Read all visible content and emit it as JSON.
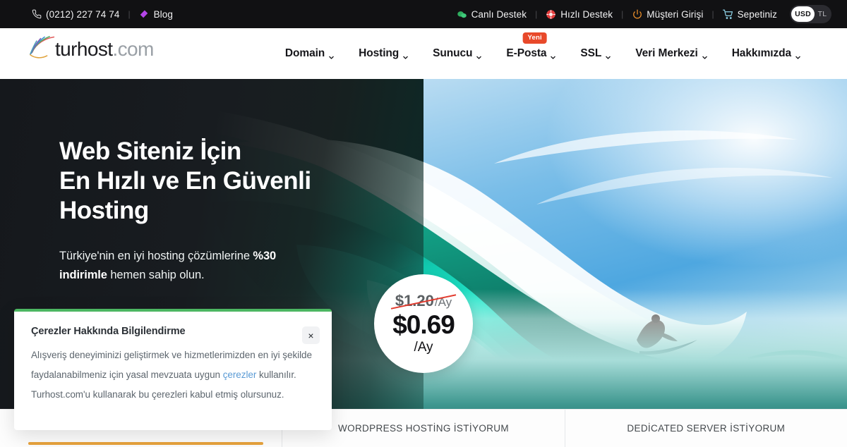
{
  "topbar": {
    "phone": "(0212) 227 74 74",
    "blog": "Blog",
    "live_support": "Canlı Destek",
    "fast_support": "Hızlı Destek",
    "client_login": "Müşteri Girişi",
    "cart": "Sepetiniz",
    "currency_active": "USD",
    "currency_inactive": "TL",
    "separator": "|",
    "colors": {
      "bg": "#111113",
      "live_support_icon": "#2fae5f",
      "fast_support_icon": "#e23b3b",
      "client_login_icon": "#f0922b",
      "cart_icon": "#8fd3e8"
    }
  },
  "header": {
    "logo_text_1": "turhost",
    "logo_text_2": ".com",
    "nav": [
      {
        "label": "Domain",
        "badge": null
      },
      {
        "label": "Hosting",
        "badge": null
      },
      {
        "label": "Sunucu",
        "badge": null
      },
      {
        "label": "E-Posta",
        "badge": "Yeni"
      },
      {
        "label": "SSL",
        "badge": null
      },
      {
        "label": "Veri Merkezi",
        "badge": null
      },
      {
        "label": "Hakkımızda",
        "badge": null
      }
    ]
  },
  "hero": {
    "title": "Web Siteniz İçin\nEn Hızlı ve En Güvenli\nHosting",
    "sub_before": "Türkiye'nin en iyi hosting çözümlerine ",
    "sub_strong": "%30 indirimle",
    "sub_after": " hemen sahip olun.",
    "price": {
      "old_amount": "$1.20",
      "old_period": "/Ay",
      "new_amount": "$0.69",
      "new_period": "/Ay",
      "strike_color": "#e23b2e"
    }
  },
  "tabs": [
    {
      "label": "",
      "active": true
    },
    {
      "label": "WORDPRESS HOSTİNG İSTİYORUM",
      "active": false
    },
    {
      "label": "DEDİCATED SERVER İSTİYORUM",
      "active": false
    }
  ],
  "tab_accent": "#e8a33d",
  "cookie": {
    "title": "Çerezler Hakkında Bilgilendirme",
    "line1": "Alışveriş deneyiminizi geliştirmek ve hizmetlerimizden en iyi",
    "line2_before": "şekilde faydalanabilmeniz için yasal mevzuata uygun ",
    "link": "çerezler",
    "line3": "kullanılır. Turhost.com'u kullanarak bu çerezleri kabul etmiş",
    "line4": "olursunuz.",
    "close_glyph": "×",
    "accent": "#4cb662"
  }
}
